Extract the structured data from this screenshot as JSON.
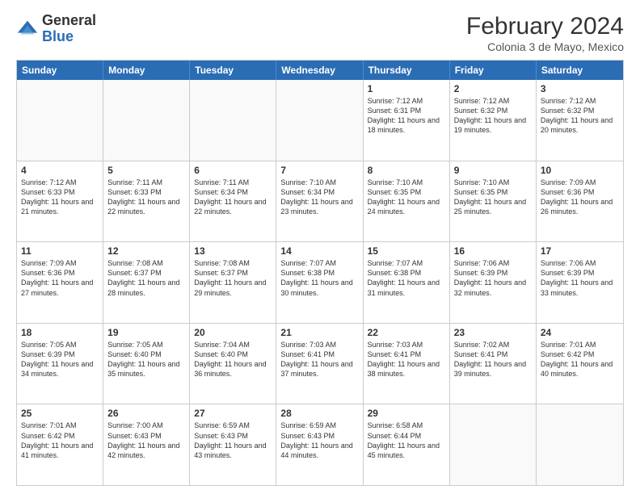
{
  "logo": {
    "general": "General",
    "blue": "Blue"
  },
  "title": "February 2024",
  "subtitle": "Colonia 3 de Mayo, Mexico",
  "headers": [
    "Sunday",
    "Monday",
    "Tuesday",
    "Wednesday",
    "Thursday",
    "Friday",
    "Saturday"
  ],
  "weeks": [
    [
      {
        "day": "",
        "text": ""
      },
      {
        "day": "",
        "text": ""
      },
      {
        "day": "",
        "text": ""
      },
      {
        "day": "",
        "text": ""
      },
      {
        "day": "1",
        "text": "Sunrise: 7:12 AM\nSunset: 6:31 PM\nDaylight: 11 hours and 18 minutes."
      },
      {
        "day": "2",
        "text": "Sunrise: 7:12 AM\nSunset: 6:32 PM\nDaylight: 11 hours and 19 minutes."
      },
      {
        "day": "3",
        "text": "Sunrise: 7:12 AM\nSunset: 6:32 PM\nDaylight: 11 hours and 20 minutes."
      }
    ],
    [
      {
        "day": "4",
        "text": "Sunrise: 7:12 AM\nSunset: 6:33 PM\nDaylight: 11 hours and 21 minutes."
      },
      {
        "day": "5",
        "text": "Sunrise: 7:11 AM\nSunset: 6:33 PM\nDaylight: 11 hours and 22 minutes."
      },
      {
        "day": "6",
        "text": "Sunrise: 7:11 AM\nSunset: 6:34 PM\nDaylight: 11 hours and 22 minutes."
      },
      {
        "day": "7",
        "text": "Sunrise: 7:10 AM\nSunset: 6:34 PM\nDaylight: 11 hours and 23 minutes."
      },
      {
        "day": "8",
        "text": "Sunrise: 7:10 AM\nSunset: 6:35 PM\nDaylight: 11 hours and 24 minutes."
      },
      {
        "day": "9",
        "text": "Sunrise: 7:10 AM\nSunset: 6:35 PM\nDaylight: 11 hours and 25 minutes."
      },
      {
        "day": "10",
        "text": "Sunrise: 7:09 AM\nSunset: 6:36 PM\nDaylight: 11 hours and 26 minutes."
      }
    ],
    [
      {
        "day": "11",
        "text": "Sunrise: 7:09 AM\nSunset: 6:36 PM\nDaylight: 11 hours and 27 minutes."
      },
      {
        "day": "12",
        "text": "Sunrise: 7:08 AM\nSunset: 6:37 PM\nDaylight: 11 hours and 28 minutes."
      },
      {
        "day": "13",
        "text": "Sunrise: 7:08 AM\nSunset: 6:37 PM\nDaylight: 11 hours and 29 minutes."
      },
      {
        "day": "14",
        "text": "Sunrise: 7:07 AM\nSunset: 6:38 PM\nDaylight: 11 hours and 30 minutes."
      },
      {
        "day": "15",
        "text": "Sunrise: 7:07 AM\nSunset: 6:38 PM\nDaylight: 11 hours and 31 minutes."
      },
      {
        "day": "16",
        "text": "Sunrise: 7:06 AM\nSunset: 6:39 PM\nDaylight: 11 hours and 32 minutes."
      },
      {
        "day": "17",
        "text": "Sunrise: 7:06 AM\nSunset: 6:39 PM\nDaylight: 11 hours and 33 minutes."
      }
    ],
    [
      {
        "day": "18",
        "text": "Sunrise: 7:05 AM\nSunset: 6:39 PM\nDaylight: 11 hours and 34 minutes."
      },
      {
        "day": "19",
        "text": "Sunrise: 7:05 AM\nSunset: 6:40 PM\nDaylight: 11 hours and 35 minutes."
      },
      {
        "day": "20",
        "text": "Sunrise: 7:04 AM\nSunset: 6:40 PM\nDaylight: 11 hours and 36 minutes."
      },
      {
        "day": "21",
        "text": "Sunrise: 7:03 AM\nSunset: 6:41 PM\nDaylight: 11 hours and 37 minutes."
      },
      {
        "day": "22",
        "text": "Sunrise: 7:03 AM\nSunset: 6:41 PM\nDaylight: 11 hours and 38 minutes."
      },
      {
        "day": "23",
        "text": "Sunrise: 7:02 AM\nSunset: 6:41 PM\nDaylight: 11 hours and 39 minutes."
      },
      {
        "day": "24",
        "text": "Sunrise: 7:01 AM\nSunset: 6:42 PM\nDaylight: 11 hours and 40 minutes."
      }
    ],
    [
      {
        "day": "25",
        "text": "Sunrise: 7:01 AM\nSunset: 6:42 PM\nDaylight: 11 hours and 41 minutes."
      },
      {
        "day": "26",
        "text": "Sunrise: 7:00 AM\nSunset: 6:43 PM\nDaylight: 11 hours and 42 minutes."
      },
      {
        "day": "27",
        "text": "Sunrise: 6:59 AM\nSunset: 6:43 PM\nDaylight: 11 hours and 43 minutes."
      },
      {
        "day": "28",
        "text": "Sunrise: 6:59 AM\nSunset: 6:43 PM\nDaylight: 11 hours and 44 minutes."
      },
      {
        "day": "29",
        "text": "Sunrise: 6:58 AM\nSunset: 6:44 PM\nDaylight: 11 hours and 45 minutes."
      },
      {
        "day": "",
        "text": ""
      },
      {
        "day": "",
        "text": ""
      }
    ]
  ]
}
